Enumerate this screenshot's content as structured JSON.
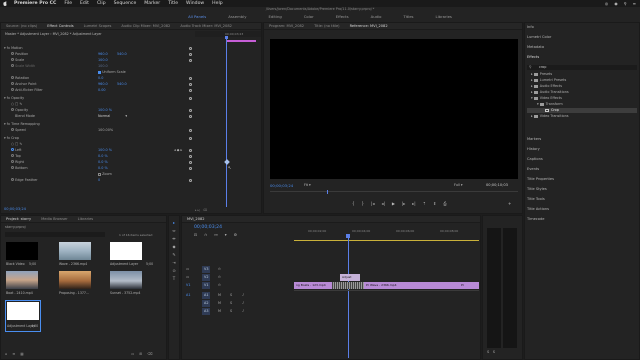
{
  "menubar": {
    "apple": "",
    "app": "Premiere Pro CC",
    "items": [
      "File",
      "Edit",
      "Clip",
      "Sequence",
      "Marker",
      "Title",
      "Window",
      "Help"
    ],
    "right": [
      "◎",
      "◉",
      "⚲",
      "≡"
    ]
  },
  "title": "/Users/Joren/Documents/Adobe/Premiere Pro/11.0/starry.prproj *",
  "workspaces": [
    "All Panels",
    "Assembly",
    "Editing",
    "Color",
    "Effects",
    "Audio",
    "Titles",
    "Libraries"
  ],
  "effect_controls": {
    "tabs": [
      "Source: (no clips)",
      "Effect Controls",
      "Lumetri Scopes",
      "Audio Clip Mixer: MVI_2082",
      "Audio Track Mixer: MVI_2082"
    ],
    "subhead": "Master * Adjustment Layer  ›  MVI_2082 * Adjustment Layer",
    "ruler_start": "00;00;03;23",
    "ruler_end": "00;00;04;23",
    "motion": {
      "label": "Motion",
      "rows": [
        {
          "name": "Position",
          "v1": "960.0",
          "v2": "540.0"
        },
        {
          "name": "Scale",
          "v1": "100.0",
          "v2": ""
        },
        {
          "name": "Scale Width",
          "v1": "100.0",
          "v2": ""
        },
        {
          "name": "",
          "v1": "Uniform Scale",
          "v2": ""
        },
        {
          "name": "Rotation",
          "v1": "0.0",
          "v2": ""
        },
        {
          "name": "Anchor Point",
          "v1": "960.0",
          "v2": "540.0"
        },
        {
          "name": "Anti-flicker Filter",
          "v1": "0.00",
          "v2": ""
        }
      ]
    },
    "opacity": {
      "label": "Opacity",
      "rows": [
        {
          "name": "Opacity",
          "v1": "100.0 %"
        },
        {
          "name": "Blend Mode",
          "v1": "Normal"
        }
      ]
    },
    "time_remapping": {
      "label": "Time Remapping",
      "speed_name": "Speed",
      "speed": "100.00%"
    },
    "crop": {
      "label": "Crop",
      "rows": [
        {
          "name": "Left",
          "v1": "100.0 %"
        },
        {
          "name": "Top",
          "v1": "0.0 %"
        },
        {
          "name": "Right",
          "v1": "0.0 %"
        },
        {
          "name": "Bottom",
          "v1": "0.0 %"
        },
        {
          "name": "",
          "v1": "Zoom"
        },
        {
          "name": "Edge Feather",
          "v1": "0"
        }
      ]
    },
    "timecode": "00;00;03;24"
  },
  "program": {
    "tabs": [
      "Program: MVI_2082",
      "Title: (no title)",
      "Reference: MVI_2082"
    ],
    "timecode": "00;00;03;24",
    "fit": "Fit",
    "quality": "Full",
    "duration": "00;00;10;03"
  },
  "right_panel": {
    "top_items": [
      "Info",
      "Lumetri Color",
      "Metadata",
      "Effects"
    ],
    "search": "crop",
    "tree": [
      {
        "label": "Presets",
        "level": 1
      },
      {
        "label": "Lumetri Presets",
        "level": 1
      },
      {
        "label": "Audio Effects",
        "level": 1
      },
      {
        "label": "Audio Transitions",
        "level": 1
      },
      {
        "label": "Video Effects",
        "level": 1
      },
      {
        "label": "Transform",
        "level": 2
      },
      {
        "label": "Crop",
        "level": 3
      },
      {
        "label": "Video Transitions",
        "level": 1
      }
    ],
    "bottom_items": [
      "Markers",
      "History",
      "Captions",
      "Events",
      "Title Properties",
      "Title Styles",
      "Title Tools",
      "Title Actions",
      "Timecode"
    ]
  },
  "project": {
    "tabs": [
      "Project: starry",
      "Media Browser",
      "Libraries"
    ],
    "file": "starry.prproj",
    "selected_info": "1 of 16 items selected",
    "items": [
      {
        "name": "Black Video",
        "dur": "5;00"
      },
      {
        "name": "Wave - 2366.mp4",
        "dur": "10;08"
      },
      {
        "name": "Adjustment Layer",
        "dur": "5;00"
      },
      {
        "name": "Boat - 2410.mp4",
        "dur": "15;00"
      },
      {
        "name": "Proposing - 1377...",
        "dur": "10;09"
      },
      {
        "name": "Sunset - 3752.mp4",
        "dur": "14;21"
      },
      {
        "name": "Adjustment Layer",
        "dur": "4;00"
      }
    ]
  },
  "tools": [
    "▸",
    "⇔",
    "⇹",
    "◆",
    "✎",
    "⇥",
    "⊙",
    "T"
  ],
  "timeline": {
    "tab": "MVI_2082",
    "timecode": "00;00;03;24",
    "ruler": [
      "00;00;02;00",
      "00;00;04;00",
      "00;00;06;00",
      "00;00;08;00"
    ],
    "tracks": [
      "V3",
      "V2",
      "V1",
      "A1",
      "A2",
      "A3"
    ],
    "clips": [
      {
        "label": "Adjust",
        "track": "V2"
      },
      {
        "label": "Pr Wave - 2366.mp4",
        "track": "V1"
      },
      {
        "label": "Pr",
        "track": "V1b"
      },
      {
        "label": "ng Boats - 123.mp4",
        "track": "V1a"
      }
    ]
  },
  "colors": {
    "accent": "#4a8ef0",
    "clip_purple": "#b88ad6",
    "clip_pink": "#d9a6e0",
    "playhead": "#5b7fe8"
  }
}
